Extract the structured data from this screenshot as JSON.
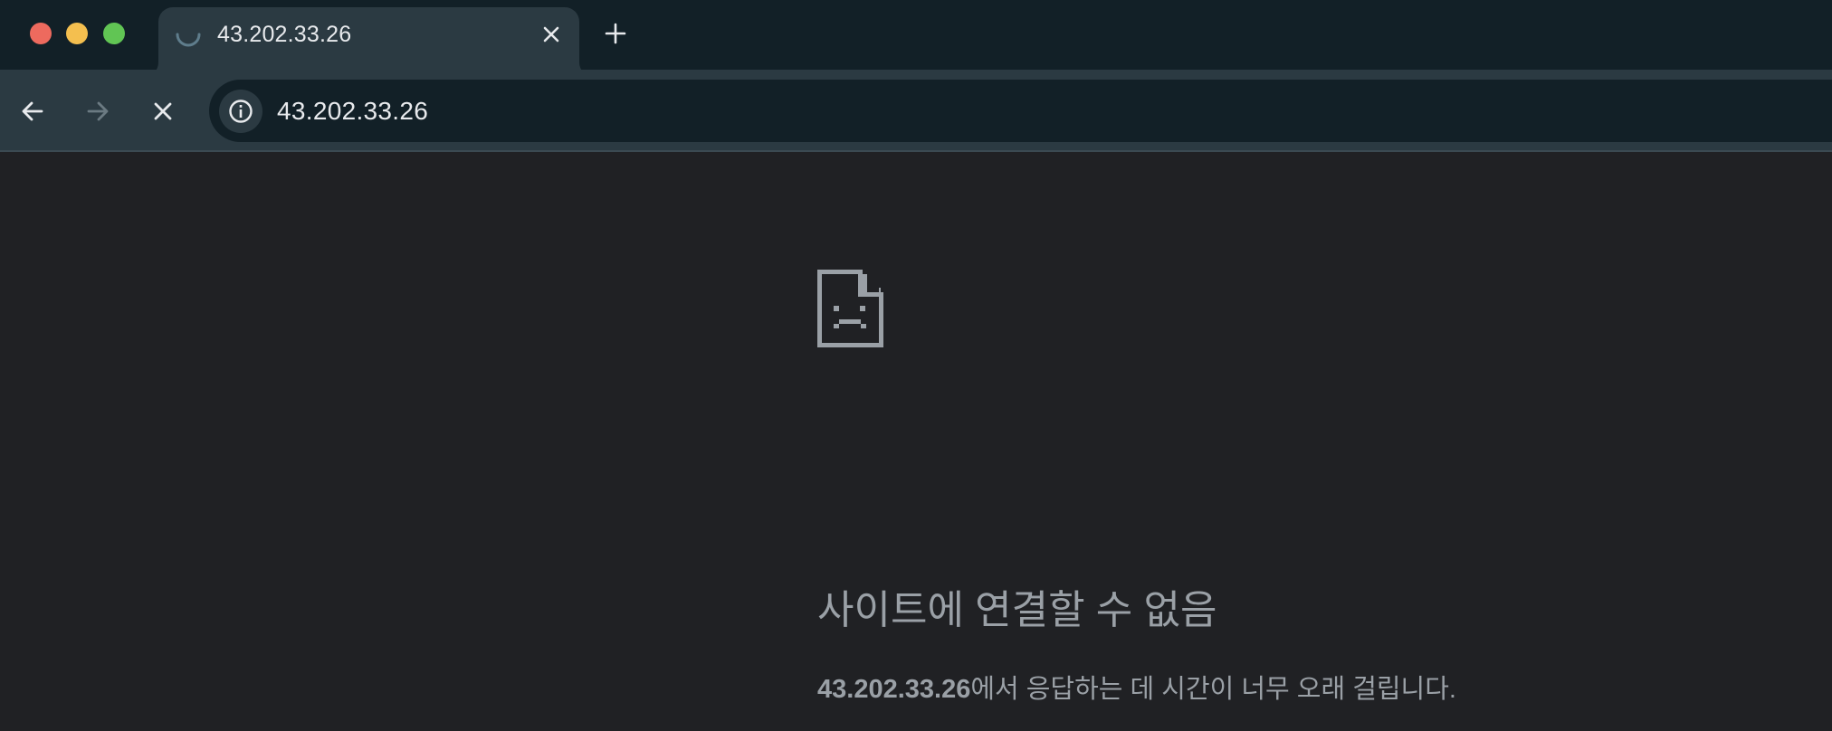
{
  "window": {
    "traffic_lights": [
      "close",
      "minimize",
      "maximize"
    ],
    "colors": {
      "close": "#ed6a5e",
      "minimize": "#f4bf4f",
      "maximize": "#61c554"
    }
  },
  "tab": {
    "title": "43.202.33.26",
    "state": "loading",
    "spinner_icon": "loading-spinner-icon",
    "close_icon": "close-icon"
  },
  "new_tab": {
    "icon": "plus-icon"
  },
  "toolbar": {
    "back_icon": "arrow-left-icon",
    "forward_icon": "arrow-right-icon",
    "forward_enabled": false,
    "stop_icon": "close-icon",
    "site_info_icon": "info-icon",
    "url": "43.202.33.26"
  },
  "error_page": {
    "icon": "sad-document-icon",
    "title": "사이트에 연결할 수 없음",
    "host": "43.202.33.26",
    "message_suffix": "에서 응답하는 데 시간이 너무 오래 걸립니다."
  },
  "colors": {
    "tab_strip_bg": "#122027",
    "toolbar_bg": "#2b3a42",
    "page_bg": "#202124",
    "error_text": "#9aa0a6"
  }
}
